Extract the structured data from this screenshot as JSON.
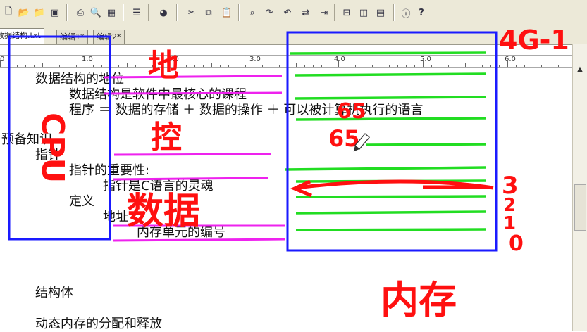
{
  "toolbar": {
    "icons": [
      "new-icon",
      "open-icon",
      "open-folder-icon",
      "save-icon",
      "print-icon",
      "print-preview-icon",
      "spreadsheet-icon",
      "align-icon",
      "web-icon",
      "cut-icon",
      "copy-icon",
      "paste-icon",
      "find-icon",
      "find-next-icon",
      "find-prev-icon",
      "replace-icon",
      "indent-icon",
      "split-view-icon",
      "columns-icon",
      "window-icon",
      "help-icon"
    ],
    "help_label": "?"
  },
  "tabs": [
    {
      "label": "数据结构.txt",
      "active": true
    },
    {
      "label": "编辑1*",
      "active": false
    },
    {
      "label": "编辑2*",
      "active": false
    }
  ],
  "ruler": {
    "labels": [
      "0",
      "1.0",
      "2.0",
      "3.0",
      "4.0",
      "5.0",
      "6.0"
    ]
  },
  "document": {
    "lines": [
      "数据结构的地位",
      "数据结构是软件中最核心的课程",
      "程序 ＝ 数据的存储 ＋ 数据的操作 ＋ 可以被计算机执行的语言",
      "预备知识",
      "指针",
      "指针的重要性:",
      "指针是C语言的灵魂",
      "定义",
      "地址",
      "内存单元的编号",
      "结构体",
      "动态内存的分配和释放"
    ]
  },
  "annotations": {
    "di_label": "地",
    "kong_label": "控",
    "shuju_label": "数据",
    "cpu_label": "CPU",
    "memory_label": "内存",
    "size_label": "4G-1",
    "num_65a": "65",
    "num_65b": "65",
    "num_3": "3",
    "num_2": "2",
    "num_1": "1",
    "num_0": "0",
    "colors": {
      "red": "#ff1010",
      "blue": "#1a1aff",
      "green": "#22dd22",
      "magenta": "#ee22ee"
    }
  }
}
